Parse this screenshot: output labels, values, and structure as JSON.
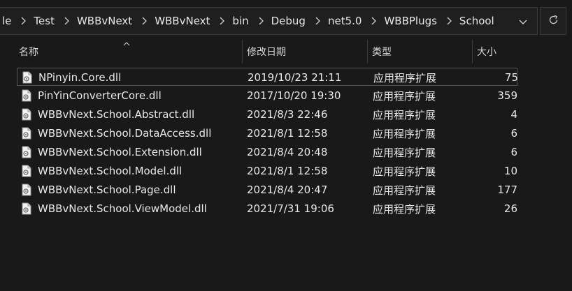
{
  "breadcrumb": [
    "le",
    "Test",
    "WBBvNext",
    "WBBvNext",
    "bin",
    "Debug",
    "net5.0",
    "WBBPlugs",
    "School"
  ],
  "columns": {
    "name": "名称",
    "date": "修改日期",
    "type": "类型",
    "size": "大小"
  },
  "files": [
    {
      "name": "NPinyin.Core.dll",
      "date": "2019/10/23 21:11",
      "type": "应用程序扩展",
      "size": "75"
    },
    {
      "name": "PinYinConverterCore.dll",
      "date": "2017/10/20 19:30",
      "type": "应用程序扩展",
      "size": "359"
    },
    {
      "name": "WBBvNext.School.Abstract.dll",
      "date": "2021/8/3 22:46",
      "type": "应用程序扩展",
      "size": "4"
    },
    {
      "name": "WBBvNext.School.DataAccess.dll",
      "date": "2021/8/1 12:58",
      "type": "应用程序扩展",
      "size": "6"
    },
    {
      "name": "WBBvNext.School.Extension.dll",
      "date": "2021/8/4 20:48",
      "type": "应用程序扩展",
      "size": "6"
    },
    {
      "name": "WBBvNext.School.Model.dll",
      "date": "2021/8/1 12:58",
      "type": "应用程序扩展",
      "size": "10"
    },
    {
      "name": "WBBvNext.School.Page.dll",
      "date": "2021/8/4 20:47",
      "type": "应用程序扩展",
      "size": "177"
    },
    {
      "name": "WBBvNext.School.ViewModel.dll",
      "date": "2021/7/31 19:06",
      "type": "应用程序扩展",
      "size": "26"
    }
  ],
  "icons": {
    "separator": "chevron-right-icon",
    "dropdown": "chevron-down-icon",
    "refresh": "refresh-icon",
    "file": "dll-file-icon"
  }
}
